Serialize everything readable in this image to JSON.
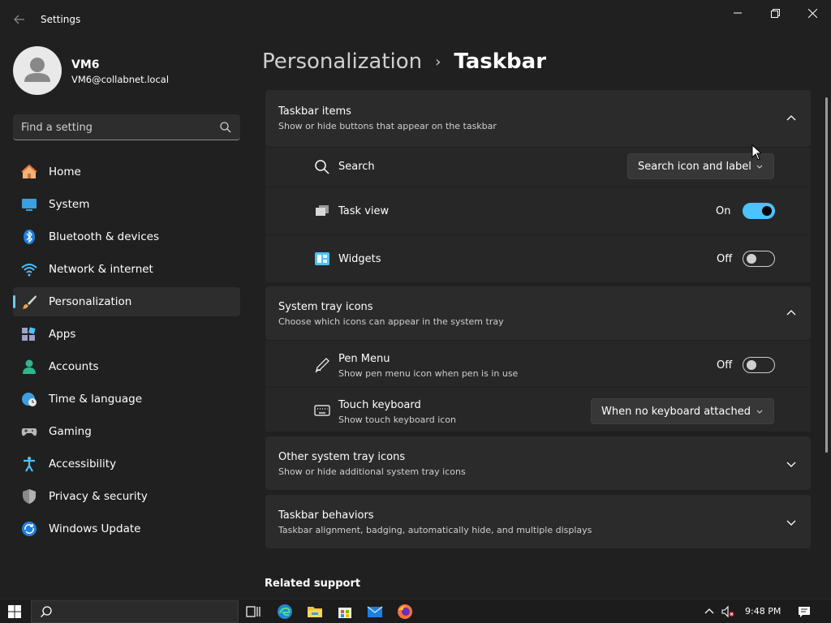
{
  "window": {
    "title": "Settings",
    "back_icon": "back-arrow-icon",
    "minimize_icon": "minimize-icon",
    "maximize_icon": "restore-icon",
    "close_icon": "close-icon"
  },
  "user": {
    "name": "VM6",
    "email": "VM6@collabnet.local"
  },
  "search": {
    "placeholder": "Find a setting"
  },
  "sidebar": {
    "items": [
      {
        "label": "Home",
        "icon": "home-icon",
        "selected": false
      },
      {
        "label": "System",
        "icon": "system-icon",
        "selected": false
      },
      {
        "label": "Bluetooth & devices",
        "icon": "bluetooth-icon",
        "selected": false
      },
      {
        "label": "Network & internet",
        "icon": "wifi-icon",
        "selected": false
      },
      {
        "label": "Personalization",
        "icon": "brush-icon",
        "selected": true
      },
      {
        "label": "Apps",
        "icon": "apps-icon",
        "selected": false
      },
      {
        "label": "Accounts",
        "icon": "accounts-icon",
        "selected": false
      },
      {
        "label": "Time & language",
        "icon": "globe-clock-icon",
        "selected": false
      },
      {
        "label": "Gaming",
        "icon": "gamepad-icon",
        "selected": false
      },
      {
        "label": "Accessibility",
        "icon": "accessibility-icon",
        "selected": false
      },
      {
        "label": "Privacy & security",
        "icon": "shield-icon",
        "selected": false
      },
      {
        "label": "Windows Update",
        "icon": "update-icon",
        "selected": false
      }
    ]
  },
  "breadcrumb": {
    "parent": "Personalization",
    "separator": "›",
    "current": "Taskbar"
  },
  "sections": {
    "taskbar_items": {
      "title": "Taskbar items",
      "description": "Show or hide buttons that appear on the taskbar",
      "expanded": true,
      "rows": {
        "search": {
          "label": "Search",
          "value": "Search icon and label"
        },
        "task_view": {
          "label": "Task view",
          "state_text": "On",
          "on": true
        },
        "widgets": {
          "label": "Widgets",
          "state_text": "Off",
          "on": false
        }
      }
    },
    "system_tray": {
      "title": "System tray icons",
      "description": "Choose which icons can appear in the system tray",
      "expanded": true,
      "rows": {
        "pen_menu": {
          "label": "Pen Menu",
          "description": "Show pen menu icon when pen is in use",
          "state_text": "Off",
          "on": false
        },
        "touch_keyboard": {
          "label": "Touch keyboard",
          "description": "Show touch keyboard icon",
          "value": "When no keyboard attached"
        }
      }
    },
    "other_tray": {
      "title": "Other system tray icons",
      "description": "Show or hide additional system tray icons",
      "expanded": false
    },
    "behaviors": {
      "title": "Taskbar behaviors",
      "description": "Taskbar alignment, badging, automatically hide, and multiple displays",
      "expanded": false
    }
  },
  "related_support": "Related support",
  "taskbar": {
    "time": "9:48 PM",
    "apps": [
      "task-view-icon",
      "edge-icon",
      "file-explorer-icon",
      "store-icon",
      "mail-icon",
      "firefox-icon"
    ],
    "tray": [
      "chevron-up-icon",
      "volume-muted-icon",
      "notification-icon"
    ]
  },
  "colors": {
    "background": "#202020",
    "card": "#2b2b2b",
    "accent": "#4cc2ff",
    "selected_bar": "#60cdff"
  }
}
